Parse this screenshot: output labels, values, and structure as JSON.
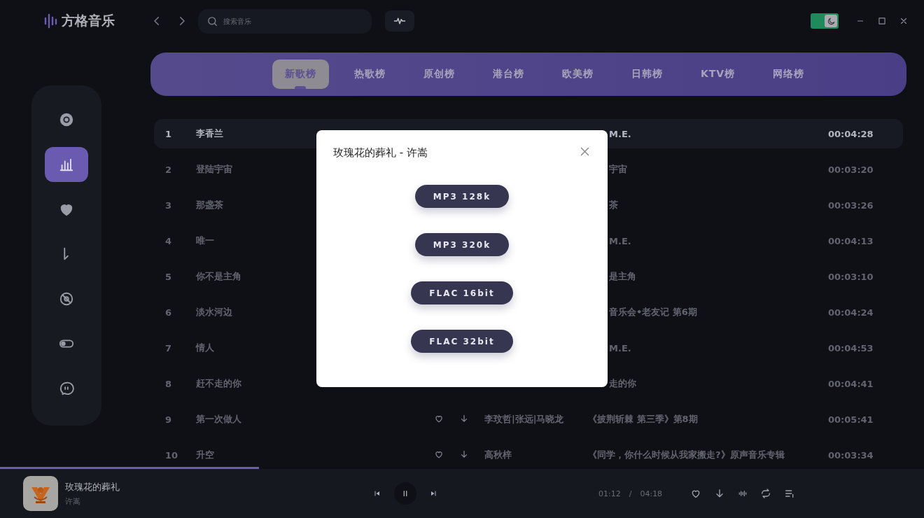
{
  "app": {
    "name": "方格音乐"
  },
  "search": {
    "placeholder": "搜索音乐"
  },
  "theme_toggle": {
    "on": true
  },
  "sidebar": {
    "items": [
      {
        "kind": "disc",
        "selected": false
      },
      {
        "kind": "chart",
        "selected": true
      },
      {
        "kind": "heart",
        "selected": false
      },
      {
        "kind": "download",
        "selected": false
      },
      {
        "kind": "vinyl",
        "selected": false
      },
      {
        "kind": "toggle",
        "selected": false
      },
      {
        "kind": "chat",
        "selected": false
      }
    ]
  },
  "tabs": [
    {
      "label": "新歌榜",
      "selected": true
    },
    {
      "label": "热歌榜",
      "selected": false
    },
    {
      "label": "原创榜",
      "selected": false
    },
    {
      "label": "港台榜",
      "selected": false
    },
    {
      "label": "欧美榜",
      "selected": false
    },
    {
      "label": "日韩榜",
      "selected": false
    },
    {
      "label": "KTV榜",
      "selected": false
    },
    {
      "label": "网络榜",
      "selected": false
    }
  ],
  "table": {
    "rows": [
      {
        "number": "1",
        "title": "李香兰",
        "album": "M.E.",
        "partly_covered": true,
        "duration": "00:04:28",
        "selected": true
      },
      {
        "number": "2",
        "title": "登陆宇宙",
        "album": "宇宙",
        "partly_covered": true,
        "duration": "00:03:20",
        "selected": false
      },
      {
        "number": "3",
        "title": "那盏茶",
        "album": "茶",
        "partly_covered": true,
        "duration": "00:03:26",
        "selected": false
      },
      {
        "number": "4",
        "title": "唯一",
        "album": "M.E.",
        "partly_covered": true,
        "duration": "00:04:13",
        "selected": false
      },
      {
        "number": "5",
        "title": "你不是主角",
        "album": "是主角",
        "partly_covered": true,
        "duration": "00:03:10",
        "selected": false
      },
      {
        "number": "6",
        "title": "淡水河边",
        "album": "音乐会•老友记 第6期",
        "partly_covered": true,
        "duration": "00:04:24",
        "selected": false
      },
      {
        "number": "7",
        "title": "情人",
        "album": "M.E.",
        "partly_covered": true,
        "duration": "00:04:53",
        "selected": false
      },
      {
        "number": "8",
        "title": "赶不走的你",
        "album": "走的你",
        "partly_covered": true,
        "duration": "00:04:41",
        "selected": false
      },
      {
        "number": "9",
        "title": "第一次做人",
        "artist": "李玟哲|张远|马晓龙",
        "album": "《披荆斩棘 第三季》第8期",
        "partly_covered": false,
        "duration": "00:05:41",
        "selected": false
      },
      {
        "number": "10",
        "title": "升空",
        "artist": "高秋梓",
        "album": "《同学，你什么时候从我家搬走?》原声音乐专辑",
        "partly_covered": false,
        "duration": "00:03:34",
        "selected": false
      }
    ]
  },
  "dialog": {
    "title": "玫瑰花的葬礼 - 许嵩",
    "options": [
      "MP3 128k",
      "MP3 320k",
      "FLAC 16bit",
      "FLAC 32bit"
    ]
  },
  "player": {
    "title": "玫瑰花的葬礼",
    "artist": "许嵩",
    "playing": true,
    "level": 0.28,
    "current_time": "01:12",
    "separator": "/",
    "total_time": "04:18"
  }
}
